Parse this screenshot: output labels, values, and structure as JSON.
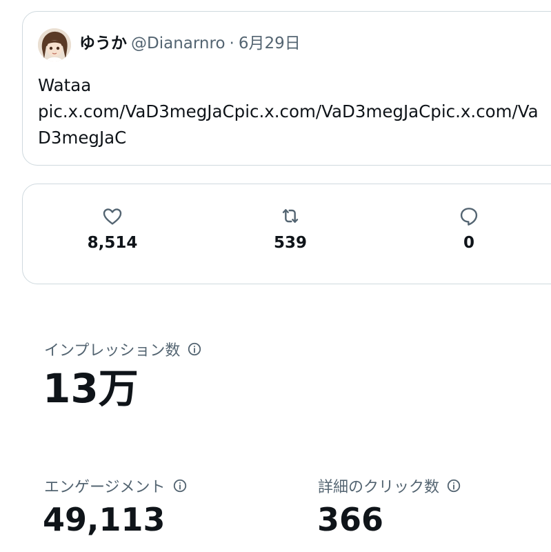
{
  "tweet": {
    "author_name": "ゆうか",
    "author_handle": "@Dianarnro",
    "separator": "·",
    "date": "6月29日",
    "text": "Wataa\npic.x.com/VaD3megJaCpic.x.com/VaD3megJaCpic.x.com/VaD3megJaC"
  },
  "metrics": {
    "likes": "8,514",
    "reposts": "539",
    "replies": "0"
  },
  "stats": {
    "impressions_label": "インプレッション数",
    "impressions_value": "13万",
    "engagements_label": "エンゲージメント",
    "engagements_value": "49,113",
    "detail_clicks_label": "詳細のクリック数",
    "detail_clicks_value": "366"
  },
  "icons": {
    "like": "heart-icon",
    "repost": "repost-icon",
    "reply": "reply-bubble-icon",
    "info": "info-icon"
  },
  "colors": {
    "text_primary": "#0f1419",
    "text_secondary": "#536471",
    "border": "#cfd9de"
  }
}
